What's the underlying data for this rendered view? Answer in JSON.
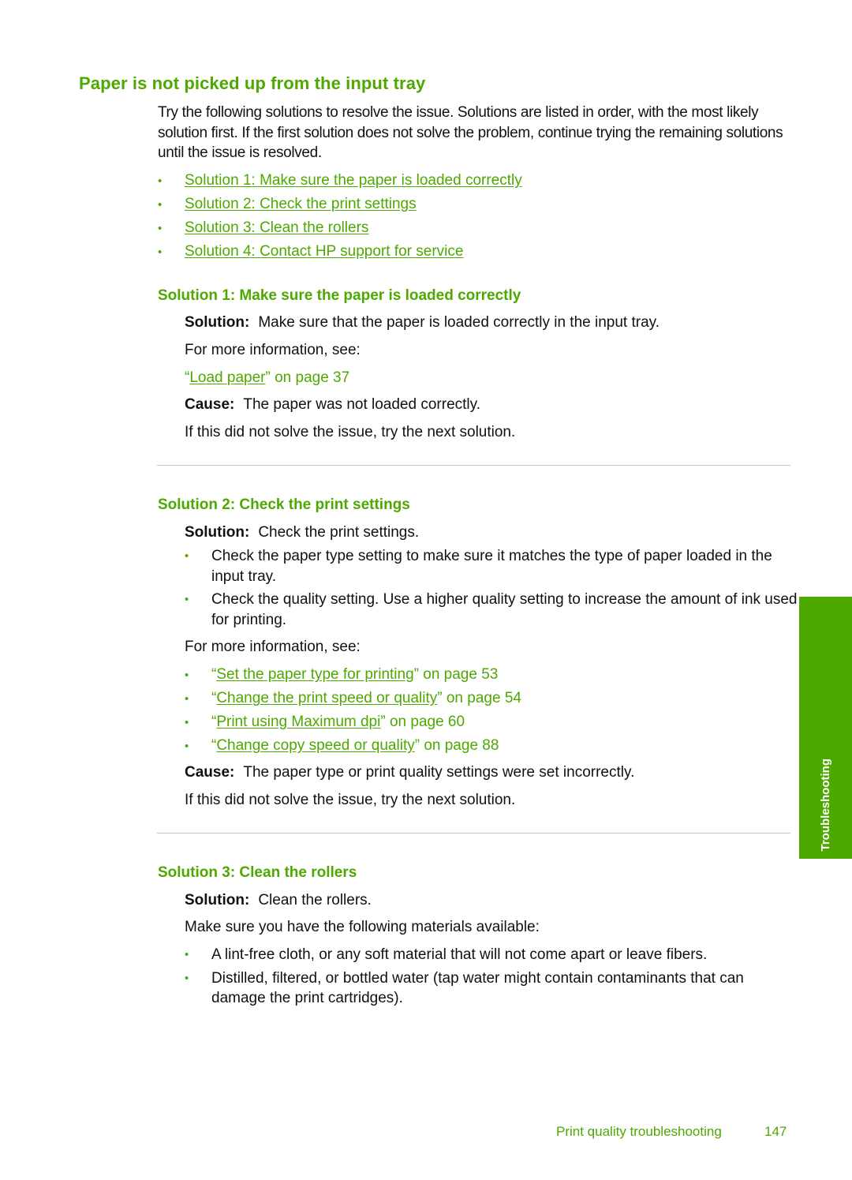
{
  "page": {
    "title": "Paper is not picked up from the input tray",
    "intro": "Try the following solutions to resolve the issue. Solutions are listed in order, with the most likely solution first. If the first solution does not solve the problem, continue trying the remaining solutions until the issue is resolved.",
    "bullet_glyph": "•",
    "toc": [
      {
        "label": "Solution 1: Make sure the paper is loaded correctly"
      },
      {
        "label": "Solution 2: Check the print settings"
      },
      {
        "label": "Solution 3: Clean the rollers"
      },
      {
        "label": "Solution 4: Contact HP support for service"
      }
    ]
  },
  "solution1": {
    "heading": "Solution 1: Make sure the paper is loaded correctly",
    "solution_label": "Solution:",
    "solution_text": "Make sure that the paper is loaded correctly in the input tray.",
    "more_info": "For more information, see:",
    "ref": {
      "open_quote": "“",
      "link": "Load paper",
      "close_quote": "”",
      "suffix": " on page 37"
    },
    "cause_label": "Cause:",
    "cause_text": "The paper was not loaded correctly.",
    "next": "If this did not solve the issue, try the next solution."
  },
  "solution2": {
    "heading": "Solution 2: Check the print settings",
    "solution_label": "Solution:",
    "solution_text": "Check the print settings.",
    "bullets": [
      "Check the paper type setting to make sure it matches the type of paper loaded in the input tray.",
      "Check the quality setting. Use a higher quality setting to increase the amount of ink used for printing."
    ],
    "more_info": "For more information, see:",
    "refs": [
      {
        "open_quote": "“",
        "link": "Set the paper type for printing",
        "close_quote": "”",
        "suffix": " on page 53"
      },
      {
        "open_quote": "“",
        "link": "Change the print speed or quality",
        "close_quote": "”",
        "suffix": " on page 54"
      },
      {
        "open_quote": "“",
        "link": "Print using Maximum dpi",
        "close_quote": "”",
        "suffix": " on page 60"
      },
      {
        "open_quote": "“",
        "link": "Change copy speed or quality",
        "close_quote": "”",
        "suffix": " on page 88"
      }
    ],
    "cause_label": "Cause:",
    "cause_text": "The paper type or print quality settings were set incorrectly.",
    "next": "If this did not solve the issue, try the next solution."
  },
  "solution3": {
    "heading": "Solution 3: Clean the rollers",
    "solution_label": "Solution:",
    "solution_text": "Clean the rollers.",
    "materials_intro": "Make sure you have the following materials available:",
    "bullets": [
      "A lint-free cloth, or any soft material that will not come apart or leave fibers.",
      "Distilled, filtered, or bottled water (tap water might contain contaminants that can damage the print cartridges)."
    ]
  },
  "side_tab": {
    "label": "Troubleshooting"
  },
  "footer": {
    "section": "Print quality troubleshooting",
    "page_number": "147"
  },
  "colors": {
    "accent": "#4da800",
    "text": "#111111",
    "divider": "#c4c4c4"
  }
}
